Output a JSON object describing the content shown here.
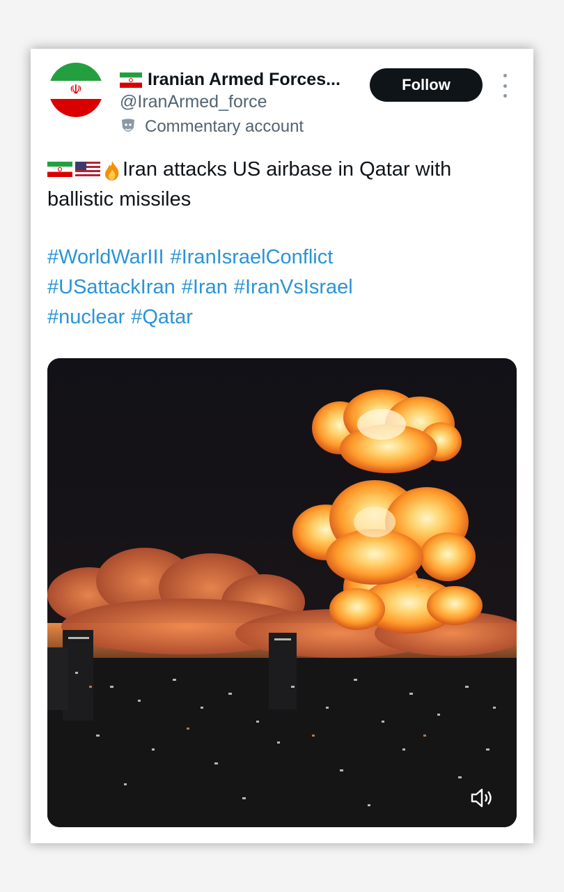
{
  "account": {
    "display_name": "Iranian Armed Forces...",
    "handle": "@IranArmed_force",
    "label": "Commentary account"
  },
  "actions": {
    "follow_label": "Follow"
  },
  "tweet": {
    "text": "Iran attacks US airbase in Qatar with ballistic missiles",
    "hashtags": [
      "#WorldWarIII",
      "#IranIsraelConflict",
      "#USattackIran",
      "#Iran",
      "#IranVsIsrael",
      "#nuclear",
      "#Qatar"
    ]
  },
  "media": {
    "type": "video",
    "sound_icon": "speaker-icon"
  },
  "colors": {
    "follow_bg": "#0f1419",
    "hashtag": "#2a94d6",
    "secondary_text": "#536471"
  }
}
